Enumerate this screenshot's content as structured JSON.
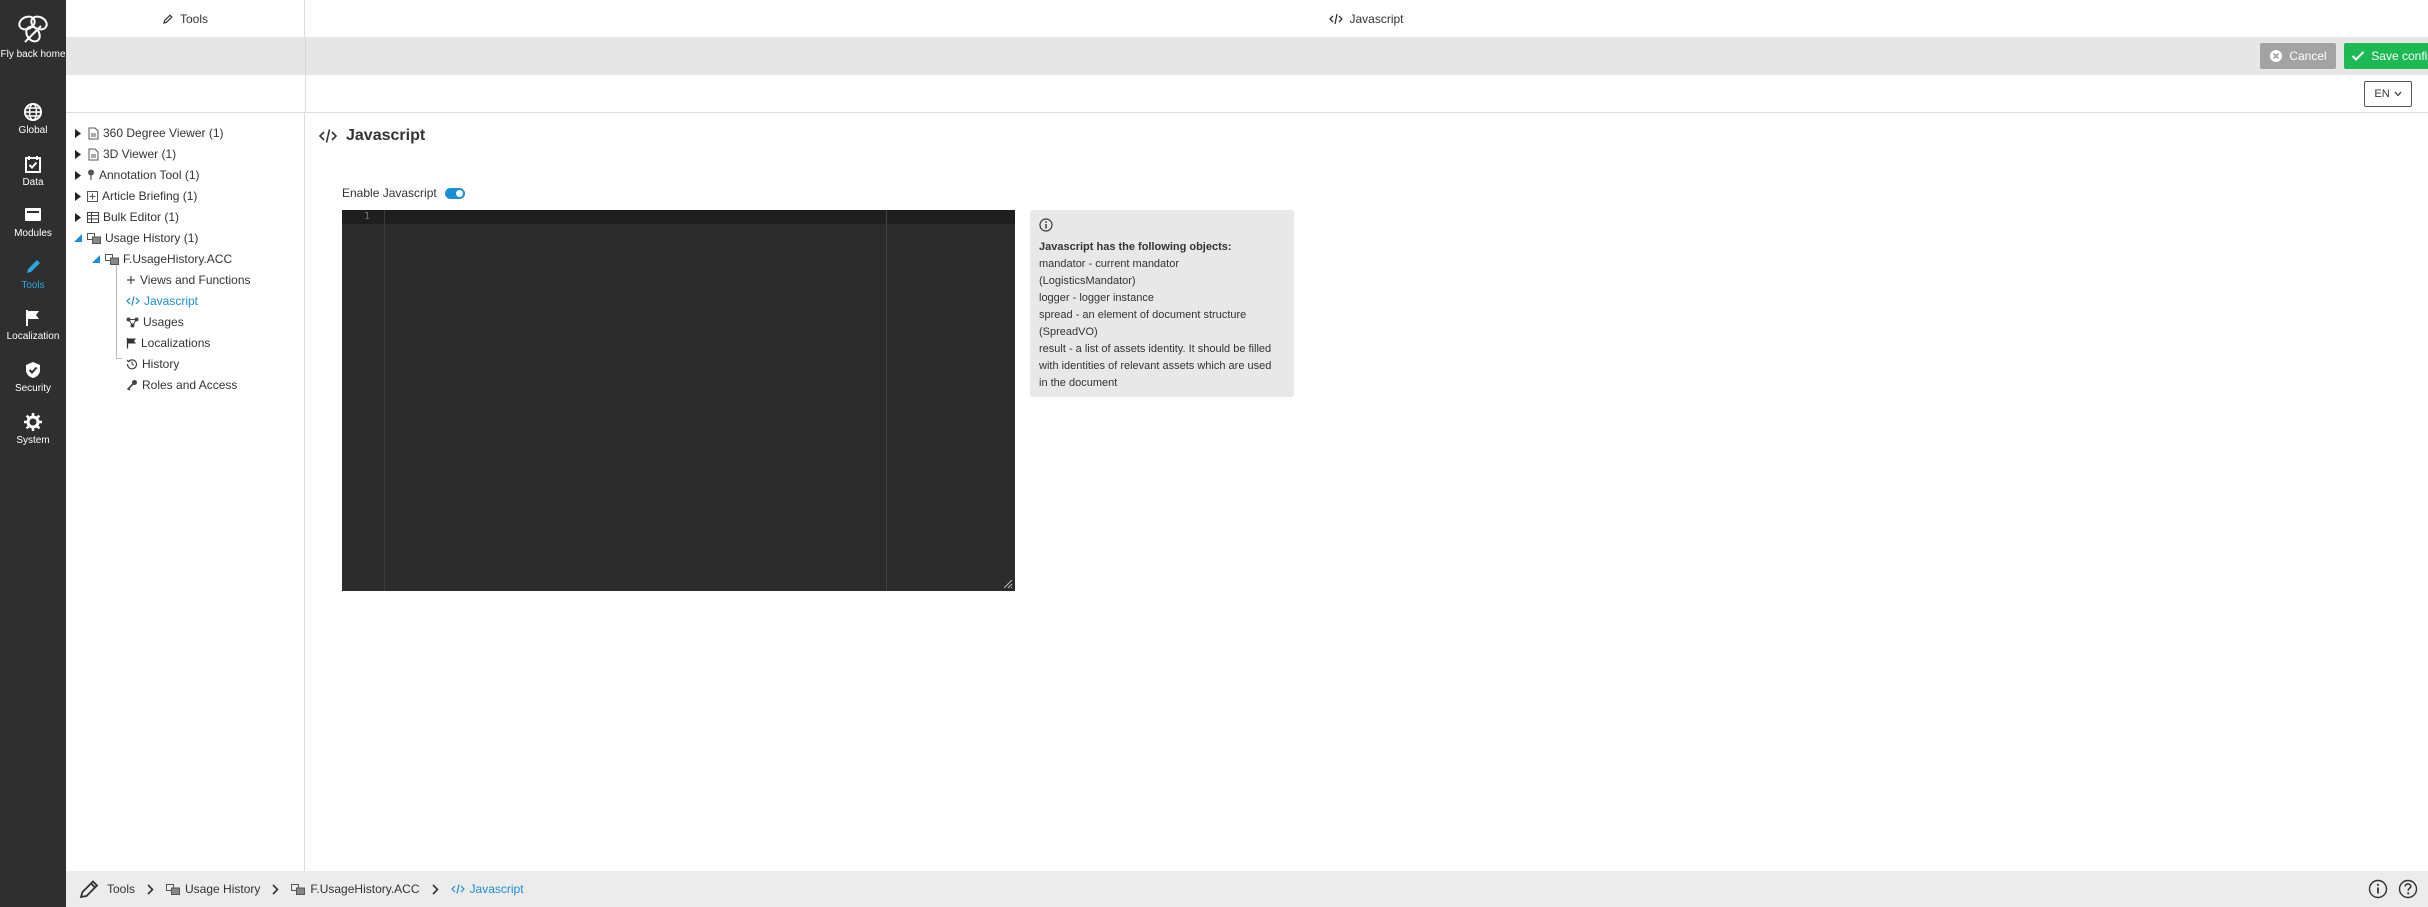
{
  "rail": {
    "logo_label": "Fly back home",
    "items": [
      {
        "label": "Global",
        "icon": "globe-icon"
      },
      {
        "label": "Data",
        "icon": "calendar-check-icon"
      },
      {
        "label": "Modules",
        "icon": "modules-icon"
      },
      {
        "label": "Tools",
        "icon": "pencil-icon",
        "active": true
      },
      {
        "label": "Localization",
        "icon": "flag-icon"
      },
      {
        "label": "Security",
        "icon": "shield-icon"
      },
      {
        "label": "System",
        "icon": "gear-icon"
      }
    ]
  },
  "header": {
    "left_title": "Tools",
    "main_title": "Javascript"
  },
  "toolbar": {
    "cancel_label": "Cancel",
    "save_label": "Save configuration"
  },
  "language": "EN",
  "tree": {
    "items": [
      {
        "label": "360 Degree Viewer (1)"
      },
      {
        "label": "3D Viewer (1)"
      },
      {
        "label": "Annotation Tool (1)"
      },
      {
        "label": "Article Briefing (1)"
      },
      {
        "label": "Bulk Editor (1)"
      },
      {
        "label": "Usage History (1)"
      },
      {
        "label": "F.UsageHistory.ACC"
      },
      {
        "label": "Views and Functions"
      },
      {
        "label": "Javascript"
      },
      {
        "label": "Usages"
      },
      {
        "label": "Localizations"
      },
      {
        "label": "History"
      },
      {
        "label": "Roles and Access"
      }
    ]
  },
  "main": {
    "title": "Javascript",
    "enable_label": "Enable Javascript",
    "enabled": true,
    "editor_line": "1"
  },
  "info": {
    "heading": "Javascript has the following objects:",
    "lines": [
      "mandator - current mandator",
      "(LogisticsMandator)",
      "logger - logger instance",
      "spread - an element of document structure",
      "(SpreadVO)",
      "result - a list of assets identity. It should be filled",
      "with identities of relevant assets which are used",
      "in the document"
    ]
  },
  "breadcrumb": [
    "Tools",
    "Usage History",
    "F.UsageHistory.ACC",
    "Javascript"
  ],
  "colors": {
    "accent": "#1a8fd6",
    "save": "#1db954",
    "cancel": "#a3a3a3",
    "rail": "#2f2f2f"
  }
}
